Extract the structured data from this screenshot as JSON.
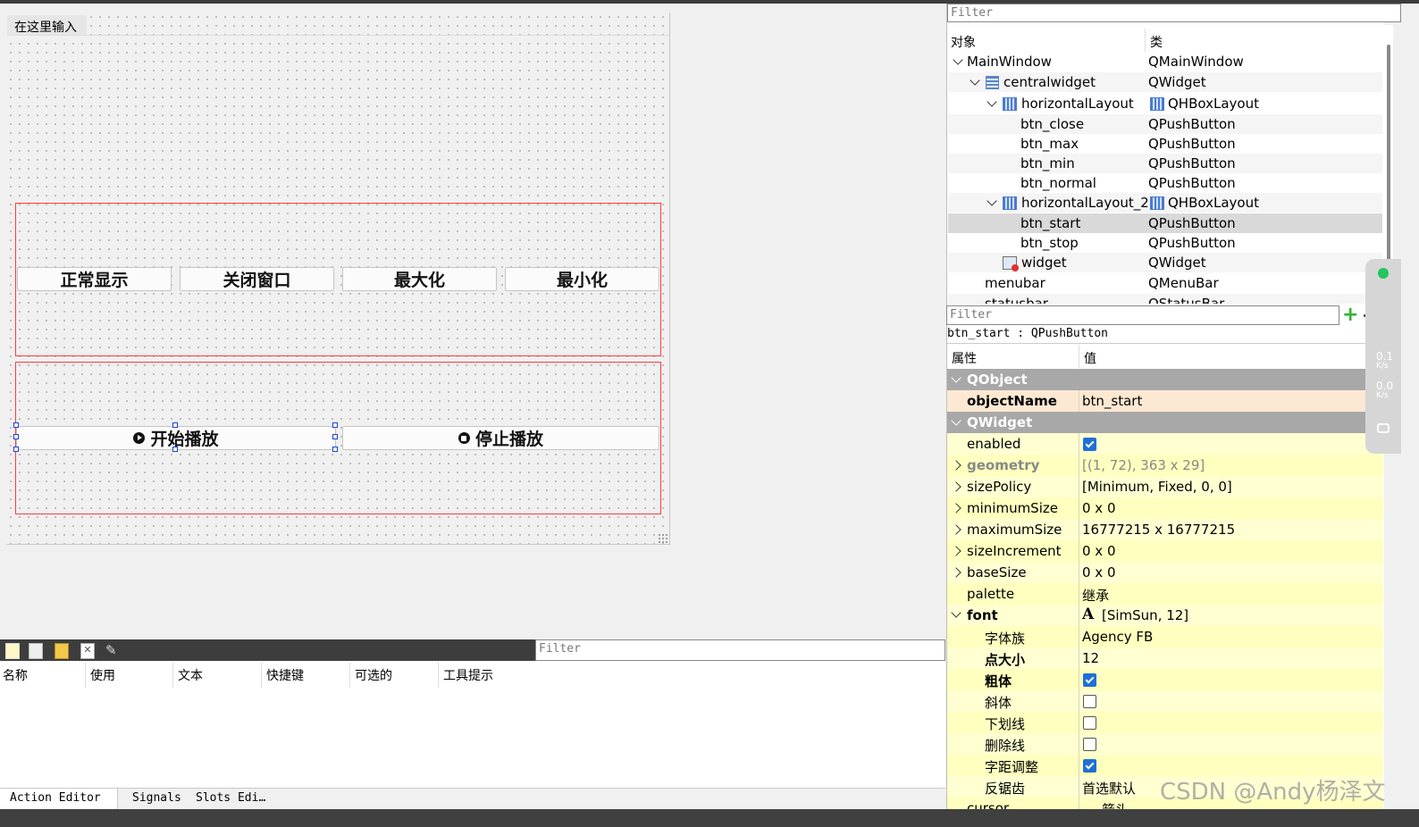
{
  "form": {
    "menu_placeholder": "在这里输入",
    "buttons_row1": [
      "正常显示",
      "关闭窗口",
      "最大化",
      "最小化"
    ],
    "btn_start": "开始播放",
    "btn_stop": "停止播放"
  },
  "object_inspector": {
    "filter_placeholder": "Filter",
    "col_object": "对象",
    "col_class": "类",
    "rows": [
      {
        "name": "MainWindow",
        "cls": "QMainWindow"
      },
      {
        "name": "centralwidget",
        "cls": "QWidget"
      },
      {
        "name": "horizontalLayout",
        "cls": "QHBoxLayout"
      },
      {
        "name": "btn_close",
        "cls": "QPushButton"
      },
      {
        "name": "btn_max",
        "cls": "QPushButton"
      },
      {
        "name": "btn_min",
        "cls": "QPushButton"
      },
      {
        "name": "btn_normal",
        "cls": "QPushButton"
      },
      {
        "name": "horizontalLayout_2",
        "cls": "QHBoxLayout"
      },
      {
        "name": "btn_start",
        "cls": "QPushButton"
      },
      {
        "name": "btn_stop",
        "cls": "QPushButton"
      },
      {
        "name": "widget",
        "cls": "QWidget"
      },
      {
        "name": "menubar",
        "cls": "QMenuBar"
      },
      {
        "name": "statusbar",
        "cls": "QStatusBar"
      }
    ]
  },
  "property_editor": {
    "filter_placeholder": "Filter",
    "selected_object": "btn_start : QPushButton",
    "col_prop": "属性",
    "col_value": "值",
    "group_qobject": "QObject",
    "objectName_label": "objectName",
    "objectName_value": "btn_start",
    "group_qwidget": "QWidget",
    "enabled_label": "enabled",
    "enabled": true,
    "geometry_label": "geometry",
    "geometry_value": "[(1, 72), 363 x 29]",
    "sizePolicy_label": "sizePolicy",
    "sizePolicy_value": "[Minimum, Fixed, 0, 0]",
    "minimumSize_label": "minimumSize",
    "minimumSize_value": "0 x 0",
    "maximumSize_label": "maximumSize",
    "maximumSize_value": "16777215 x 16777215",
    "sizeIncrement_label": "sizeIncrement",
    "sizeIncrement_value": "0 x 0",
    "baseSize_label": "baseSize",
    "baseSize_value": "0 x 0",
    "palette_label": "palette",
    "palette_value": "继承",
    "font_label": "font",
    "font_value": "[SimSun, 12]",
    "font_icon": "A",
    "family_label": "字体族",
    "family_value": "Agency FB",
    "pointsize_label": "点大小",
    "pointsize_value": "12",
    "bold_label": "粗体",
    "bold": true,
    "italic_label": "斜体",
    "italic": false,
    "underline_label": "下划线",
    "underline": false,
    "strikeout_label": "删除线",
    "strikeout": false,
    "kerning_label": "字距调整",
    "kerning": true,
    "antialias_label": "反锯齿",
    "antialias_value": "首选默认",
    "cursor_label": "cursor",
    "cursor_value": "箭头"
  },
  "action_editor": {
    "filter_placeholder": "Filter",
    "columns": [
      "名称",
      "使用",
      "文本",
      "快捷键",
      "可选的",
      "工具提示"
    ],
    "tabs": [
      "Action Editor",
      "Signals",
      "Slots Edi…"
    ]
  },
  "side_widget": {
    "up": "0.1",
    "down": "0.0",
    "unit": "K/s"
  },
  "watermark": "CSDN @Andy杨泽文",
  "colors": {
    "layout_border": "#ff3b3b",
    "selection_handle": "#1c3fd6",
    "property_yellow": "#ffffd2",
    "group_gray": "#a8a8a8"
  }
}
